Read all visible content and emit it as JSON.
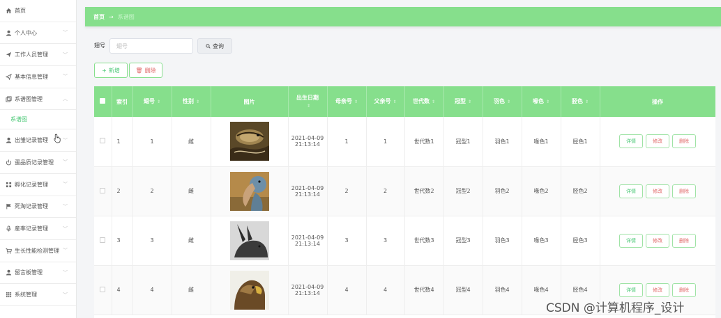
{
  "sidebar": {
    "items": [
      {
        "label": "首页",
        "icon": "home-icon",
        "chevron": false
      },
      {
        "label": "个人中心",
        "icon": "user-icon",
        "chevron": true
      },
      {
        "label": "工作人员管理",
        "icon": "send-icon",
        "chevron": true
      },
      {
        "label": "基本信息管理",
        "icon": "send-icon",
        "chevron": true
      },
      {
        "label": "系谱图管理",
        "icon": "copy-icon",
        "chevron": true,
        "expanded": true
      },
      {
        "label": "出雏记录管理",
        "icon": "user-icon",
        "chevron": true
      },
      {
        "label": "蛋品质记录管理",
        "icon": "power-icon",
        "chevron": true
      },
      {
        "label": "孵化记录管理",
        "icon": "grid-icon",
        "chevron": true
      },
      {
        "label": "死淘记录管理",
        "icon": "flag-icon",
        "chevron": true
      },
      {
        "label": "産率记录管理",
        "icon": "mic-icon",
        "chevron": true
      },
      {
        "label": "生长性能检测管理",
        "icon": "cart-icon",
        "chevron": true
      },
      {
        "label": "留言板管理",
        "icon": "user-icon",
        "chevron": true
      },
      {
        "label": "系统管理",
        "icon": "grid-icon",
        "chevron": true
      }
    ],
    "submenu_label": "系谱图"
  },
  "breadcrumb": {
    "home": "首页",
    "arrow": "→",
    "current": "系谱图"
  },
  "search": {
    "label": "翅号",
    "placeholder": "翅号",
    "button_label": "查询"
  },
  "actions": {
    "add_label": "新增",
    "delete_label": "删除"
  },
  "table": {
    "columns": [
      "索引",
      "翅号",
      "性别",
      "图片",
      "出生日期",
      "母亲号",
      "父亲号",
      "世代数",
      "冠型",
      "羽色",
      "喙色",
      "胫色",
      "操作"
    ],
    "rows": [
      {
        "index": "1",
        "wing": "1",
        "gender": "雌",
        "date": "2021-04-09",
        "time": "21:13:14",
        "mother": "1",
        "father": "1",
        "generation": "世代数1",
        "comb": "冠型1",
        "feather": "羽色1",
        "beak": "喙色1",
        "shank": "胫色1"
      },
      {
        "index": "2",
        "wing": "2",
        "gender": "雌",
        "date": "2021-04-09",
        "time": "21:13:14",
        "mother": "2",
        "father": "2",
        "generation": "世代数2",
        "comb": "冠型2",
        "feather": "羽色2",
        "beak": "喙色2",
        "shank": "胫色2"
      },
      {
        "index": "3",
        "wing": "3",
        "gender": "雌",
        "date": "2021-04-09",
        "time": "21:13:14",
        "mother": "3",
        "father": "3",
        "generation": "世代数3",
        "comb": "冠型3",
        "feather": "羽色3",
        "beak": "喙色3",
        "shank": "胫色3"
      },
      {
        "index": "4",
        "wing": "4",
        "gender": "雌",
        "date": "2021-04-09",
        "time": "21:13:14",
        "mother": "4",
        "father": "4",
        "generation": "世代数4",
        "comb": "冠型4",
        "feather": "羽色4",
        "beak": "喙色4",
        "shank": "胫色4"
      }
    ],
    "op_labels": {
      "detail": "详情",
      "edit": "修改",
      "delete": "删除"
    }
  },
  "watermark": "CSDN @计算机程序_设计",
  "colors": {
    "accent": "#86df8c",
    "accent_text": "#48c774",
    "danger": "#e06666"
  }
}
